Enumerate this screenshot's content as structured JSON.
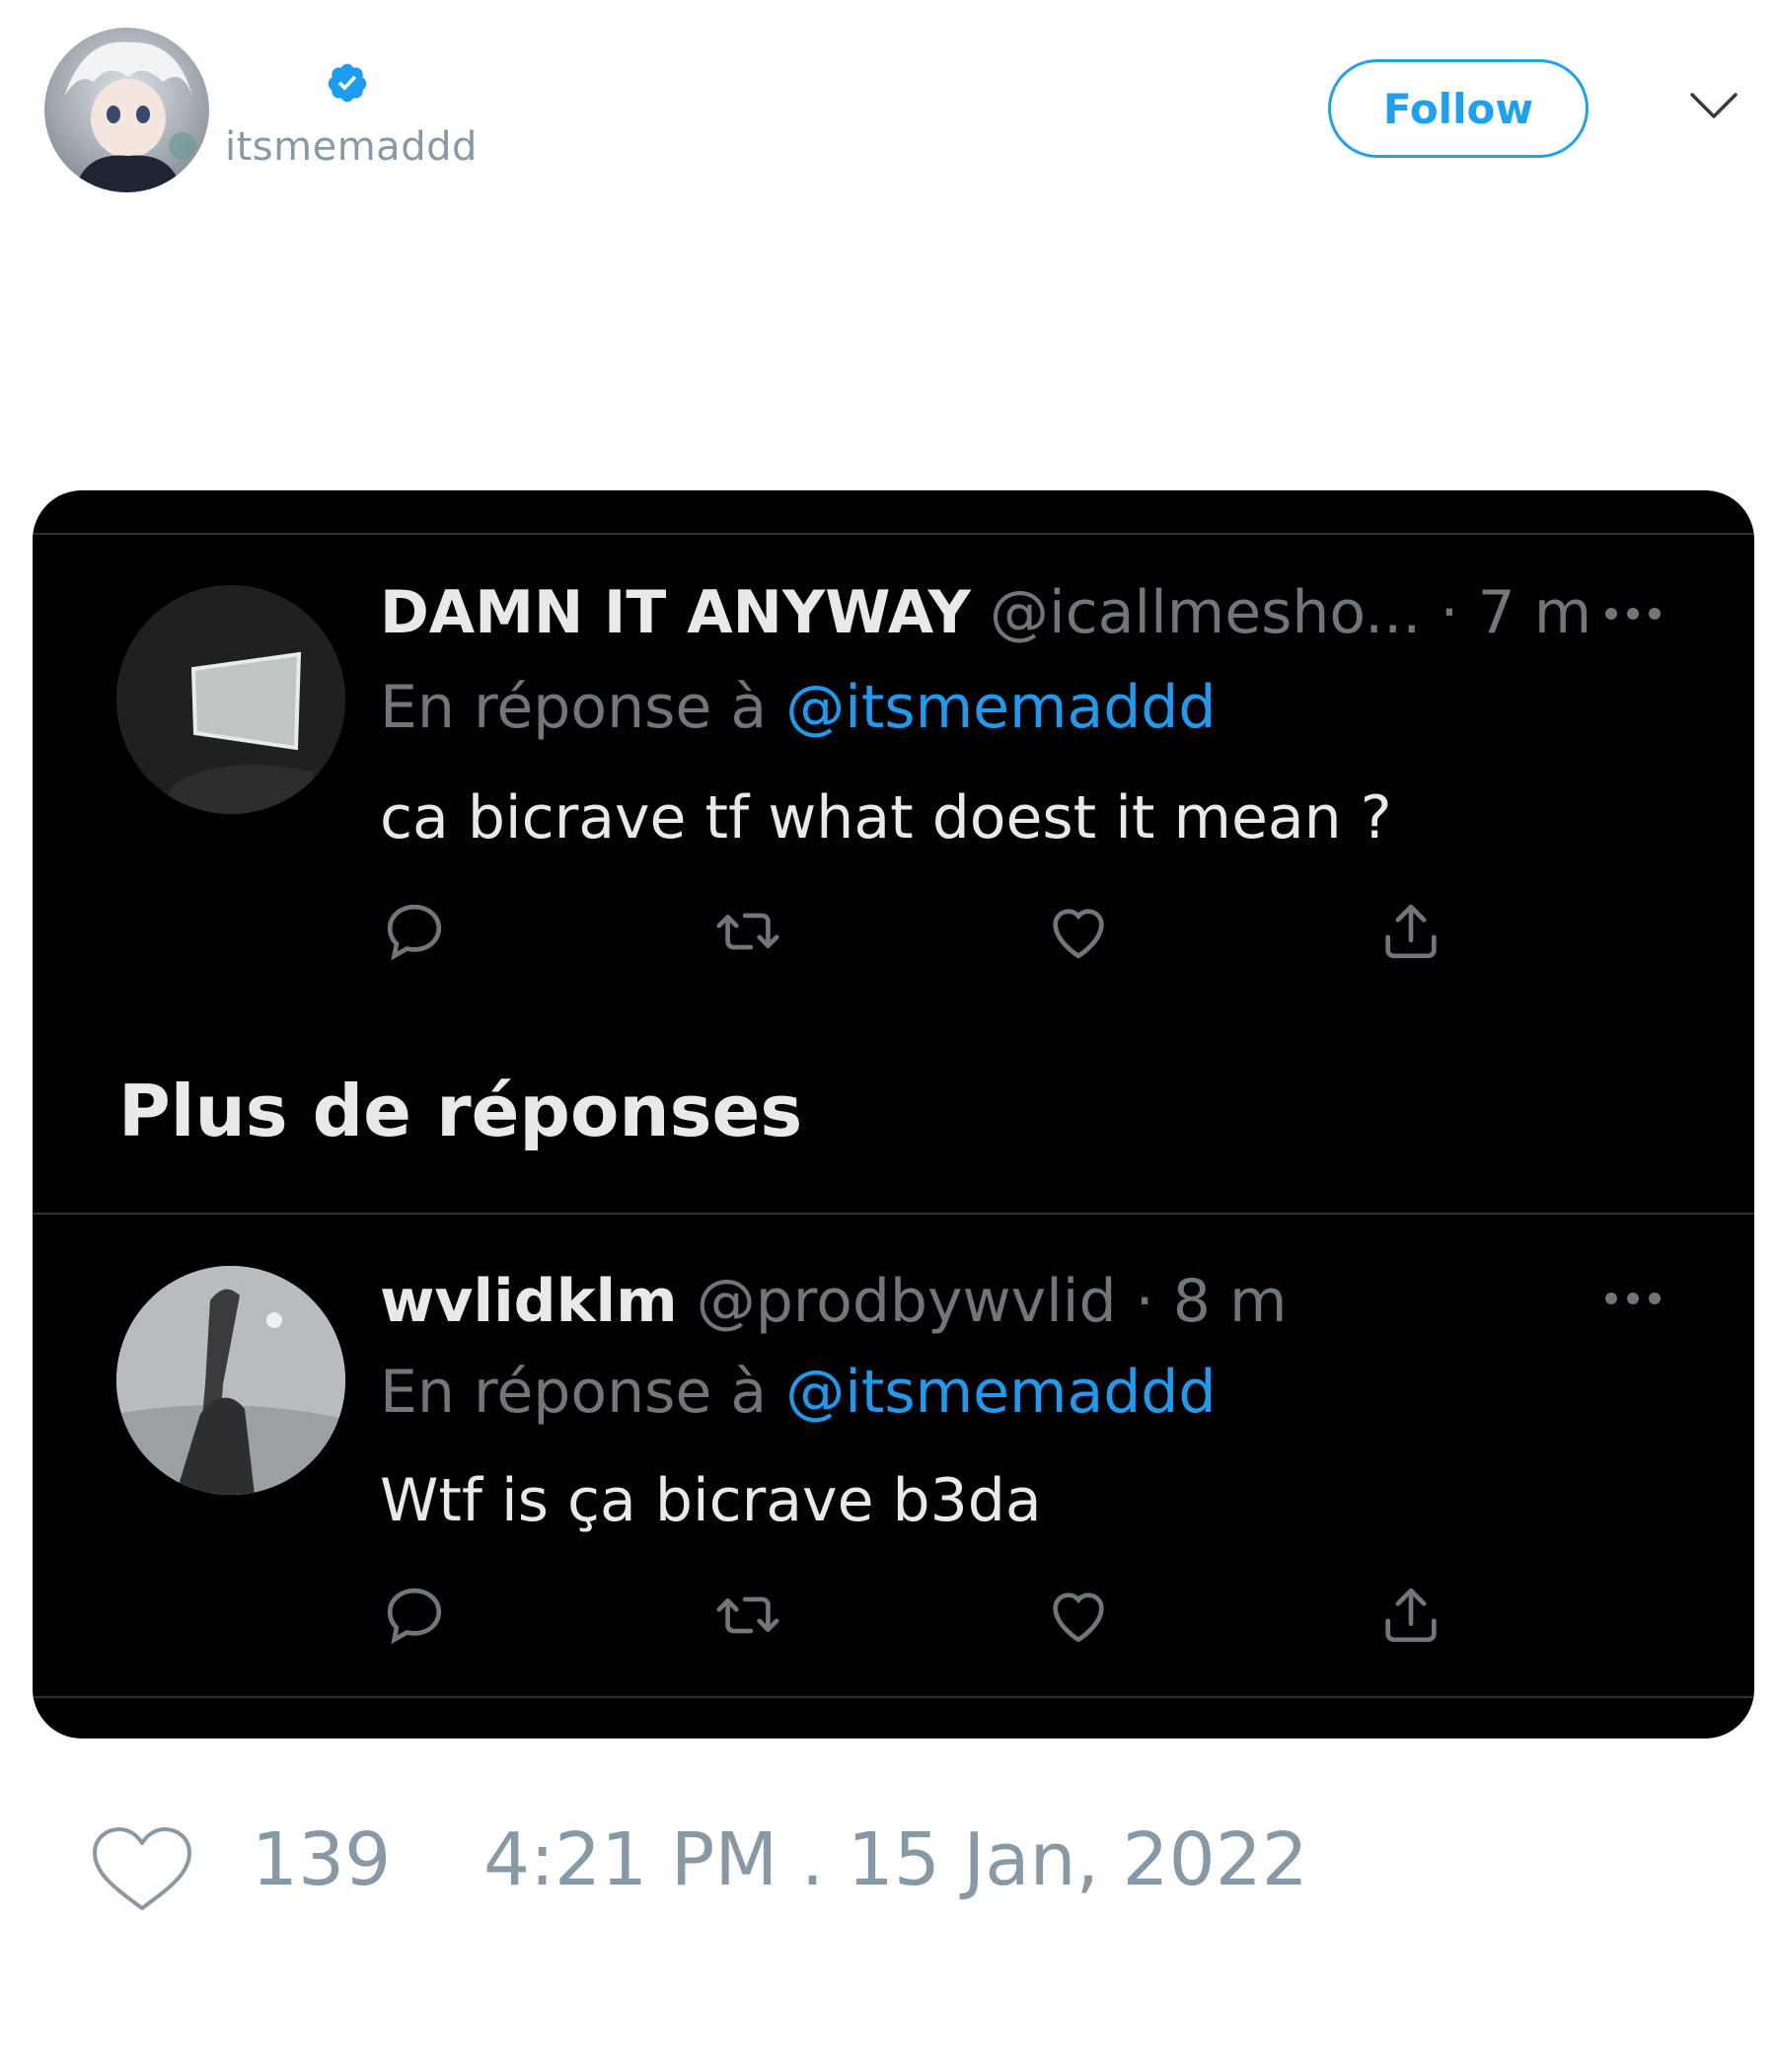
{
  "header": {
    "handle": "itsmemaddd",
    "follow_label": "Follow"
  },
  "screenshot": {
    "replies": [
      {
        "display_name": "DAMN IT ANYWAY",
        "meta": "@icallmesho... · 7 m",
        "reply_prefix": "En réponse à ",
        "reply_to": "@itsmemaddd",
        "text": "ca bicrave tf what doest it mean ?"
      },
      {
        "display_name": "wvlidklm",
        "meta": "@prodbywvlid · 8 m",
        "reply_prefix": "En réponse à ",
        "reply_to": "@itsmemaddd",
        "text": "Wtf is ça bicrave b3da"
      }
    ],
    "section_title": "Plus de réponses"
  },
  "footer": {
    "likes": "139",
    "timestamp": "4:21 PM . 15 Jan, 2022"
  },
  "colors": {
    "accent": "#1da1f2",
    "link": "#1d9bf0",
    "muted": "#8899a6",
    "dark_bg": "#000000"
  },
  "icons": [
    "verified-badge-icon",
    "chevron-down-icon",
    "more-icon",
    "reply-icon",
    "retweet-icon",
    "like-icon",
    "share-icon",
    "heart-outline-icon"
  ]
}
